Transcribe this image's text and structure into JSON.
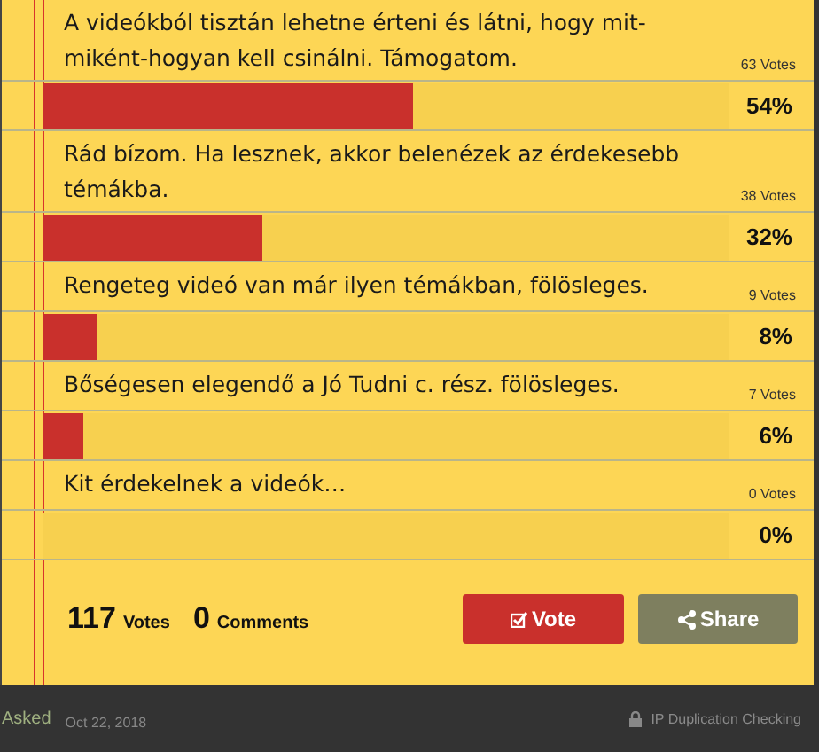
{
  "options": [
    {
      "text": "A videókból tisztán lehetne érteni és látni, hogy mit-miként-hogyan kell csinálni. Támogatom.",
      "votes": "63 Votes",
      "level": 0.54,
      "percent": "54%"
    },
    {
      "text": "Rád bízom. Ha lesznek, akkor belenézek az érdekesebb témákba.",
      "votes": "38 Votes",
      "level": 0.32,
      "percent": "32%"
    },
    {
      "text": "Rengeteg videó van már ilyen témákban, fölösleges.",
      "votes": "9 Votes",
      "level": 0.08,
      "percent": "8%"
    },
    {
      "text": "Bőségesen elegendő a Jó Tudni c. rész. fölösleges.",
      "votes": "7 Votes",
      "level": 0.06,
      "percent": "6%"
    },
    {
      "text": "Kit érdekelnek a videók…",
      "votes": "0 Votes",
      "level": 0,
      "percent": "0%"
    }
  ],
  "totals": {
    "votes": "117",
    "votes_label": "Votes",
    "comments": "0",
    "comments_label": "Comments"
  },
  "buttons": {
    "vote": "Vote",
    "share": "Share"
  },
  "footer": {
    "asked": "Asked",
    "date": "Oct 22, 2018",
    "ip": "IP Duplication Checking"
  }
}
